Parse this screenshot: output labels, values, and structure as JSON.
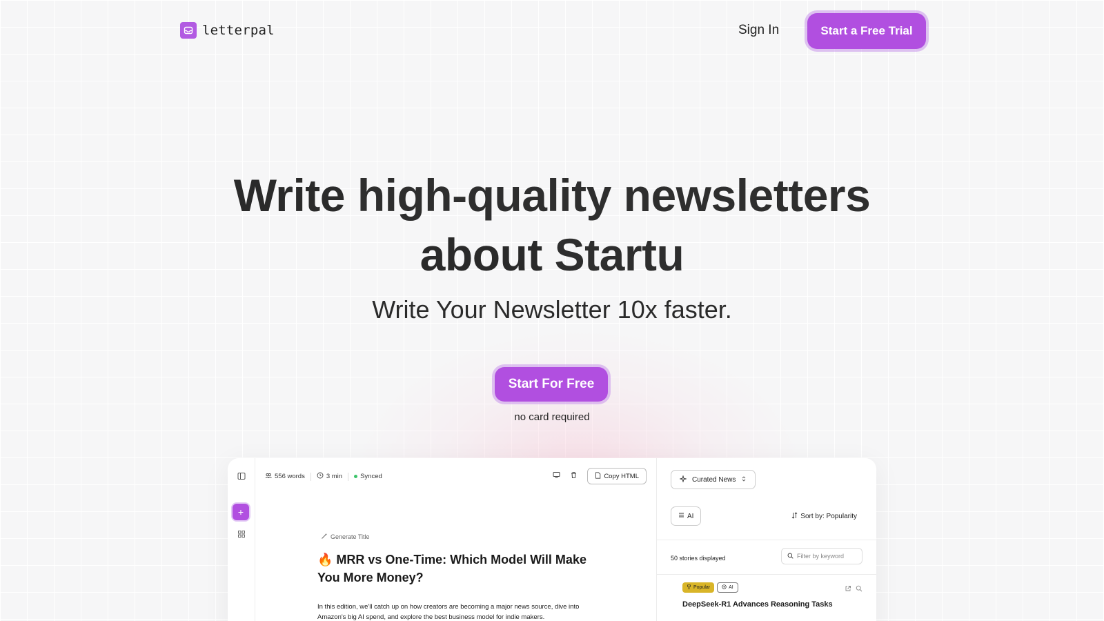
{
  "nav": {
    "logo_text": "letterpal",
    "signin_label": "Sign In",
    "trial_label": "Start a Free Trial"
  },
  "hero": {
    "title_line1_normal": "Write ",
    "title_line1_bold": "high-quality newsletters",
    "title_line2_normal": "about ",
    "title_line2_bold": "Startu",
    "subtitle": "Write Your Newsletter 10x faster.",
    "cta_label": "Start For Free",
    "cta_note": "no card required"
  },
  "editor": {
    "word_count": "556 words",
    "read_time": "3 min",
    "sync_status": "Synced",
    "copy_label": "Copy HTML",
    "generate_label": "Generate Title",
    "article_title": "🔥 MRR vs One-Time: Which Model Will Make You More Money?",
    "article_body": "In this edition, we'll catch up on how creators are becoming a major news source, dive into Amazon's big AI spend, and explore the best business model for indie makers."
  },
  "side_panel": {
    "source_label": "Curated News",
    "category_label": "AI",
    "sort_label": "Sort by: Popularity",
    "count_label": "50 stories displayed",
    "filter_placeholder": "Filter by keyword",
    "story": {
      "badge_popular": "Popular",
      "badge_ai": "AI",
      "title": "DeepSeek-R1 Advances Reasoning Tasks"
    }
  },
  "colors": {
    "accent": "#b14fe0",
    "badge_popular": "#d9b528",
    "synced_dot": "#3cc46a"
  }
}
